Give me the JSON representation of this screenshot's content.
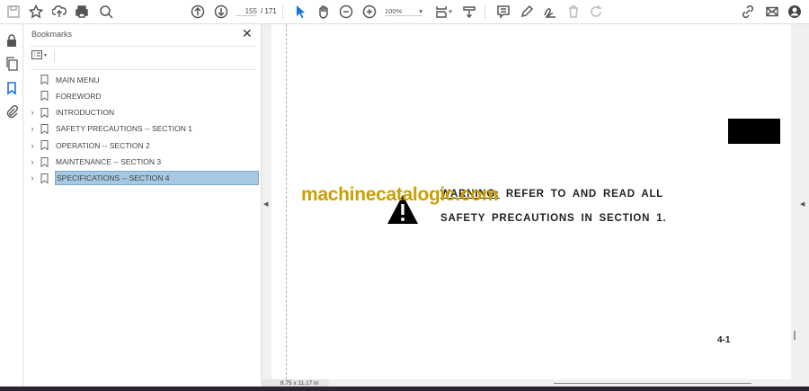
{
  "toolbar": {
    "page_current": "155",
    "page_sep": "/",
    "page_total": "171",
    "zoom": "100%"
  },
  "panel": {
    "title": "Bookmarks",
    "close": "✕"
  },
  "bookmarks": [
    {
      "label": "MAIN MENU",
      "expandable": false
    },
    {
      "label": "FOREWORD",
      "expandable": false
    },
    {
      "label": "INTRODUCTION",
      "expandable": true
    },
    {
      "label": "SAFETY PRECAUTIONS -- SECTION 1",
      "expandable": true
    },
    {
      "label": "OPERATION -- SECTION 2",
      "expandable": true
    },
    {
      "label": "MAINTENANCE -- SECTION 3",
      "expandable": true
    },
    {
      "label": "SPECIFICATIONS -- SECTION 4",
      "expandable": true,
      "selected": true
    }
  ],
  "document": {
    "watermark": "machinecatalogic.com",
    "warning_word": "WARNING:",
    "line1": "REFER TO AND READ ALL",
    "line2": "SAFETY PRECAUTIONS IN SECTION 1.",
    "page_number": "4-1"
  },
  "status": {
    "page_size": "8.75 x 11.17 in"
  },
  "colors": {
    "selection": "#a6c8e2",
    "watermark": "#c9a000",
    "accent": "#1473e6"
  }
}
